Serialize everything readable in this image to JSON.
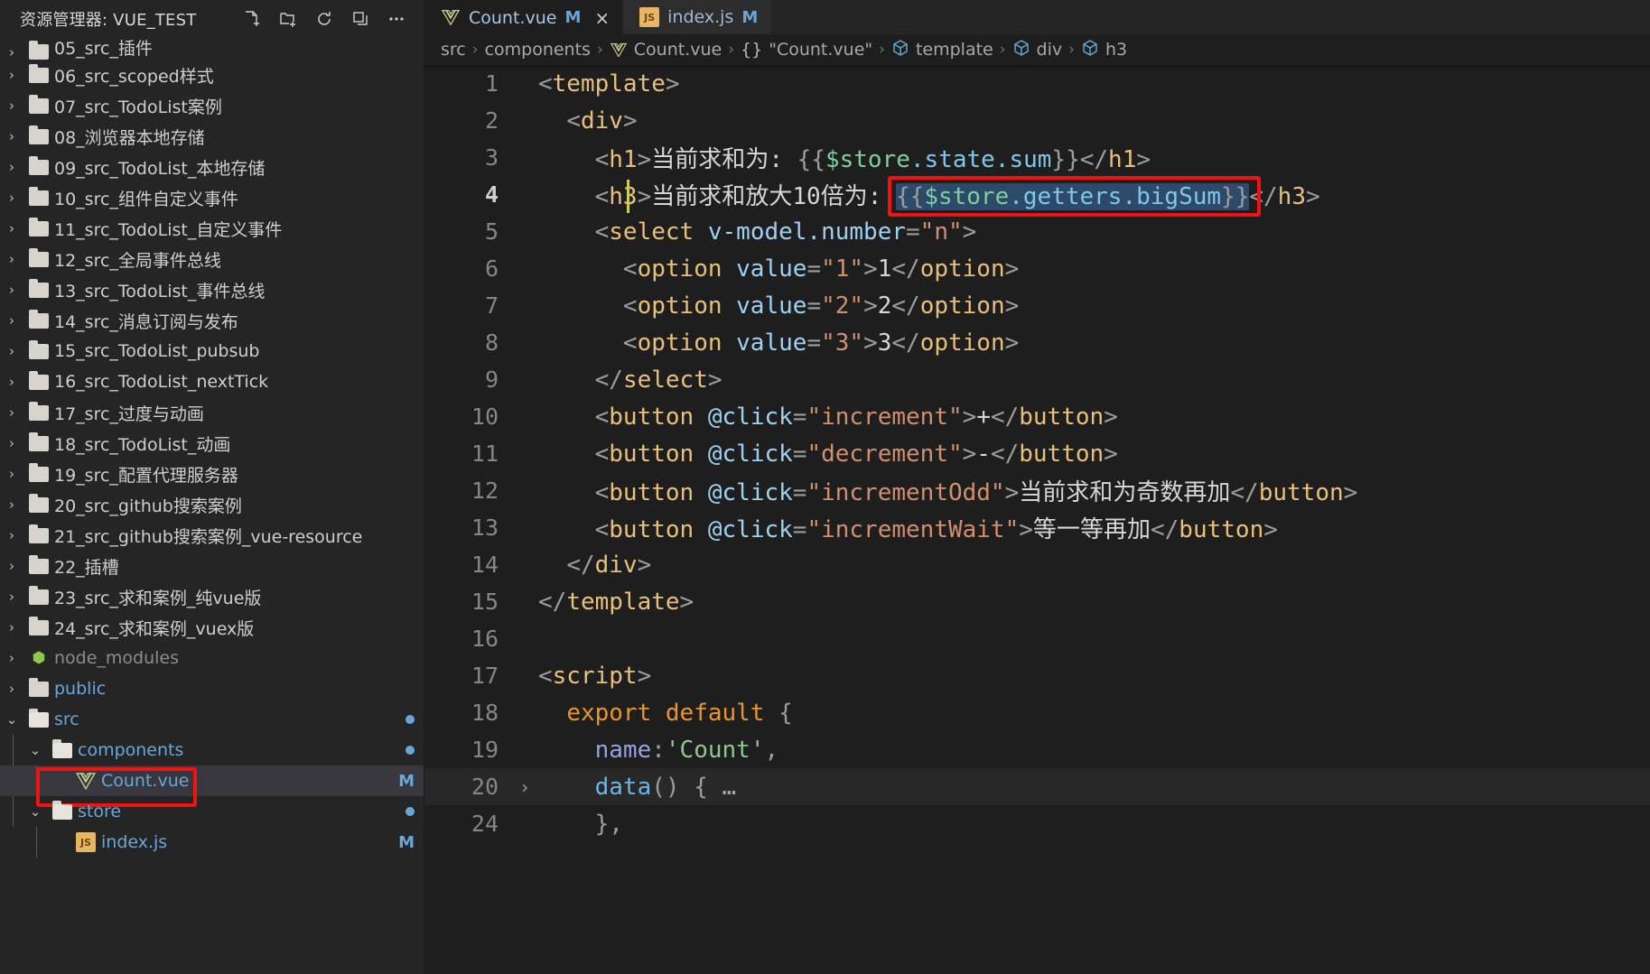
{
  "sidebar": {
    "header": {
      "title": "资源管理器: VUE_TEST",
      "actions": [
        {
          "name": "new-file-icon",
          "label": "新建文件"
        },
        {
          "name": "new-folder-icon",
          "label": "新建文件夹"
        },
        {
          "name": "refresh-icon",
          "label": "刷新"
        },
        {
          "name": "collapse-all-icon",
          "label": "折叠文件夹"
        },
        {
          "name": "more-actions-icon",
          "label": "..."
        }
      ]
    },
    "tree": [
      {
        "label": "05_src_插件",
        "type": "folder",
        "depth": 0,
        "expanded": false,
        "clipped": true
      },
      {
        "label": "06_src_scoped样式",
        "type": "folder",
        "depth": 0,
        "expanded": false
      },
      {
        "label": "07_src_TodoList案例",
        "type": "folder",
        "depth": 0,
        "expanded": false
      },
      {
        "label": "08_浏览器本地存储",
        "type": "folder",
        "depth": 0,
        "expanded": false
      },
      {
        "label": "09_src_TodoList_本地存储",
        "type": "folder",
        "depth": 0,
        "expanded": false
      },
      {
        "label": "10_src_组件自定义事件",
        "type": "folder",
        "depth": 0,
        "expanded": false
      },
      {
        "label": "11_src_TodoList_自定义事件",
        "type": "folder",
        "depth": 0,
        "expanded": false
      },
      {
        "label": "12_src_全局事件总线",
        "type": "folder",
        "depth": 0,
        "expanded": false
      },
      {
        "label": "13_src_TodoList_事件总线",
        "type": "folder",
        "depth": 0,
        "expanded": false
      },
      {
        "label": "14_src_消息订阅与发布",
        "type": "folder",
        "depth": 0,
        "expanded": false
      },
      {
        "label": "15_src_TodoList_pubsub",
        "type": "folder",
        "depth": 0,
        "expanded": false
      },
      {
        "label": "16_src_TodoList_nextTick",
        "type": "folder",
        "depth": 0,
        "expanded": false
      },
      {
        "label": "17_src_过度与动画",
        "type": "folder",
        "depth": 0,
        "expanded": false
      },
      {
        "label": "18_src_TodoList_动画",
        "type": "folder",
        "depth": 0,
        "expanded": false
      },
      {
        "label": "19_src_配置代理服务器",
        "type": "folder",
        "depth": 0,
        "expanded": false
      },
      {
        "label": "20_src_github搜索案例",
        "type": "folder",
        "depth": 0,
        "expanded": false
      },
      {
        "label": "21_src_github搜索案例_vue-resource",
        "type": "folder",
        "depth": 0,
        "expanded": false
      },
      {
        "label": "22_插槽",
        "type": "folder",
        "depth": 0,
        "expanded": false
      },
      {
        "label": "23_src_求和案例_纯vue版",
        "type": "folder",
        "depth": 0,
        "expanded": false
      },
      {
        "label": "24_src_求和案例_vuex版",
        "type": "folder",
        "depth": 0,
        "expanded": false
      },
      {
        "label": "node_modules",
        "type": "node",
        "depth": 0,
        "expanded": false,
        "dim": true
      },
      {
        "label": "public",
        "type": "folder",
        "depth": 0,
        "expanded": false,
        "blue": true
      },
      {
        "label": "src",
        "type": "folder",
        "depth": 0,
        "expanded": true,
        "blue": true,
        "dot": true
      },
      {
        "label": "components",
        "type": "folder",
        "depth": 1,
        "expanded": true,
        "blue": true,
        "dot": true
      },
      {
        "label": "Count.vue",
        "type": "vue",
        "depth": 2,
        "selected": true,
        "blue": true,
        "badge": "M",
        "annotated": true
      },
      {
        "label": "store",
        "type": "folder",
        "depth": 1,
        "expanded": true,
        "blue": true,
        "dot": true
      },
      {
        "label": "index.js",
        "type": "js",
        "depth": 2,
        "blue": true,
        "badge": "M"
      }
    ]
  },
  "editor": {
    "tabs": [
      {
        "name": "Count.vue",
        "icon": "vue-icon",
        "modified_mark": "M",
        "active": true,
        "close": "×"
      },
      {
        "name": "index.js",
        "icon": "js-icon",
        "modified_mark": "M",
        "active": false
      }
    ],
    "breadcrumb": [
      {
        "label": "src",
        "icon": null
      },
      {
        "label": "components",
        "icon": null
      },
      {
        "label": "Count.vue",
        "icon": "vue-icon"
      },
      {
        "label": "\"Count.vue\"",
        "icon": "braces-icon"
      },
      {
        "label": "template",
        "icon": "symbol-cube-icon"
      },
      {
        "label": "div",
        "icon": "symbol-cube-icon"
      },
      {
        "label": "h3",
        "icon": "symbol-cube-icon"
      }
    ],
    "breadcrumb_separator": "›",
    "active_line": 4,
    "lines": [
      {
        "n": "1",
        "text": "<template>"
      },
      {
        "n": "2",
        "text": "  <div>"
      },
      {
        "n": "3",
        "text": "    <h1>当前求和为: {{$store.state.sum}}</h1>"
      },
      {
        "n": "4",
        "text": "    <h3>当前求和放大10倍为: {{$store.getters.bigSum}}</h3>"
      },
      {
        "n": "5",
        "text": "    <select v-model.number=\"n\">"
      },
      {
        "n": "6",
        "text": "      <option value=\"1\">1</option>"
      },
      {
        "n": "7",
        "text": "      <option value=\"2\">2</option>"
      },
      {
        "n": "8",
        "text": "      <option value=\"3\">3</option>"
      },
      {
        "n": "9",
        "text": "    </select>"
      },
      {
        "n": "10",
        "text": "    <button @click=\"increment\">+</button>"
      },
      {
        "n": "11",
        "text": "    <button @click=\"decrement\">-</button>"
      },
      {
        "n": "12",
        "text": "    <button @click=\"incrementOdd\">当前求和为奇数再加</button>"
      },
      {
        "n": "13",
        "text": "    <button @click=\"incrementWait\">等一等再加</button>"
      },
      {
        "n": "14",
        "text": "  </div>"
      },
      {
        "n": "15",
        "text": "</template>"
      },
      {
        "n": "16",
        "text": ""
      },
      {
        "n": "17",
        "text": "<script>"
      },
      {
        "n": "18",
        "text": "  export default {"
      },
      {
        "n": "19",
        "text": "    name:'Count',"
      },
      {
        "n": "20",
        "text": "    data() { …",
        "folded": true
      },
      {
        "n": "24",
        "text": "    },"
      }
    ],
    "selection_text": "{{$store.getters.bigSum}}"
  },
  "annotations": {
    "color": "#f31212",
    "boxes": [
      {
        "target": "sidebar-count-vue-row"
      },
      {
        "target": "editor-line-4-expression"
      }
    ]
  }
}
